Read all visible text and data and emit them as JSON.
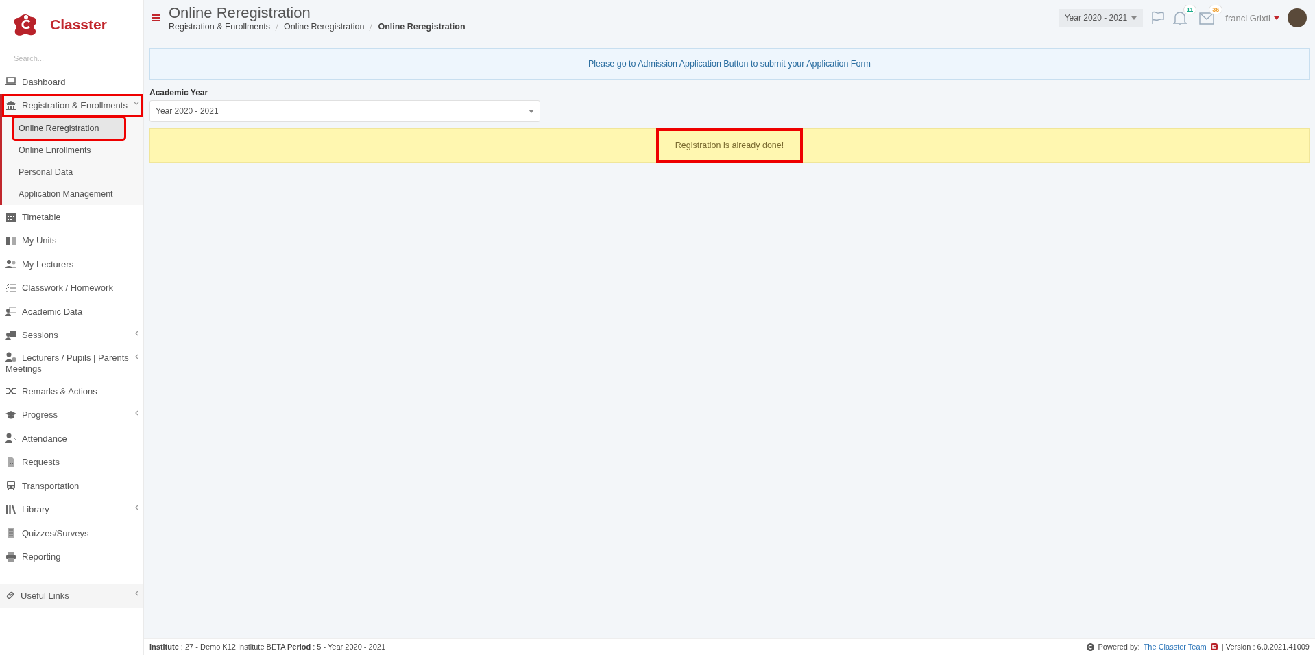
{
  "brand": {
    "name": "Classter"
  },
  "sidebar": {
    "search": {
      "placeholder": "Search..."
    },
    "items": [
      {
        "label": "Dashboard",
        "expandable": false,
        "highlighted": false
      },
      {
        "label": "Registration & Enrollments",
        "expandable": true,
        "expanded": true,
        "highlighted": true,
        "children": [
          {
            "label": "Online Reregistration",
            "selected": true,
            "highlighted": true
          },
          {
            "label": "Online Enrollments",
            "selected": false,
            "highlighted": false
          },
          {
            "label": "Personal Data",
            "selected": false,
            "highlighted": false
          },
          {
            "label": "Application Management",
            "selected": false,
            "highlighted": false
          }
        ]
      },
      {
        "label": "Timetable",
        "expandable": false,
        "highlighted": false
      },
      {
        "label": "My Units",
        "expandable": false,
        "highlighted": false
      },
      {
        "label": "My Lecturers",
        "expandable": false,
        "highlighted": false
      },
      {
        "label": "Classwork / Homework",
        "expandable": false,
        "highlighted": false
      },
      {
        "label": "Academic Data",
        "expandable": false,
        "highlighted": false
      },
      {
        "label": "Sessions",
        "expandable": true,
        "expanded": false,
        "highlighted": false
      },
      {
        "label": "Lecturers / Pupils | Parents Meetings",
        "expandable": true,
        "expanded": false,
        "highlighted": false
      },
      {
        "label": "Remarks & Actions",
        "expandable": false,
        "highlighted": false
      },
      {
        "label": "Progress",
        "expandable": true,
        "expanded": false,
        "highlighted": false
      },
      {
        "label": "Attendance",
        "expandable": false,
        "highlighted": false
      },
      {
        "label": "Requests",
        "expandable": false,
        "highlighted": false
      },
      {
        "label": "Transportation",
        "expandable": false,
        "highlighted": false
      },
      {
        "label": "Library",
        "expandable": true,
        "expanded": false,
        "highlighted": false
      },
      {
        "label": "Quizzes/Surveys",
        "expandable": false,
        "highlighted": false
      },
      {
        "label": "Reporting",
        "expandable": false,
        "highlighted": false
      }
    ],
    "bottom_item": {
      "label": "Useful Links",
      "expandable": true
    }
  },
  "header": {
    "title": "Online Reregistration",
    "breadcrumb": [
      "Registration & Enrollments",
      "Online Reregistration",
      "Online Reregistration"
    ],
    "year_select": "Year 2020 - 2021",
    "badges": [
      {
        "count": "11",
        "color": "#1aab8a"
      },
      {
        "count": "36",
        "color": "#f0a030"
      }
    ],
    "user": "franci Grixti"
  },
  "info": "Please go to Admission Application Button to submit your Application Form",
  "academic_year": {
    "label": "Academic Year",
    "value": "Year 2020 - 2021"
  },
  "alert": {
    "text": "Registration is already done!",
    "highlighted": true
  },
  "footer": {
    "institute_label": "Institute",
    "institute": " : 27 - Demo K12 Institute BETA ",
    "period_label": "Period",
    "period": " : 5 - Year 2020 - 2021",
    "powered_by": "Powered by:",
    "team": "The Classter Team",
    "version": "| Version : 6.0.2021.41009"
  }
}
